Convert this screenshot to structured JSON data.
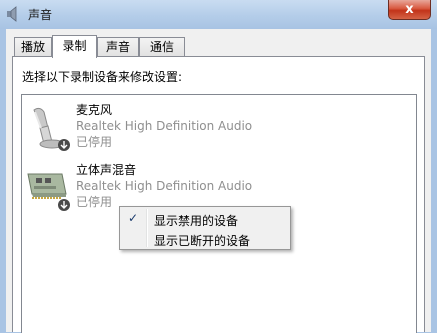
{
  "window": {
    "title": "声音",
    "title_icon": "speaker-icon",
    "close_symbol": "x"
  },
  "tabs": [
    {
      "label": "播放",
      "active": false
    },
    {
      "label": "录制",
      "active": true
    },
    {
      "label": "声音",
      "active": false
    },
    {
      "label": "通信",
      "active": false
    }
  ],
  "recording": {
    "instruction": "选择以下录制设备来修改设置:",
    "devices": [
      {
        "name": "麦克风",
        "driver": "Realtek High Definition Audio",
        "status": "已停用",
        "icon": "microphone-icon"
      },
      {
        "name": "立体声混音",
        "driver": "Realtek High Definition Audio",
        "status": "已停用",
        "icon": "sound-card-icon"
      }
    ]
  },
  "context_menu": {
    "items": [
      {
        "label": "显示禁用的设备",
        "checked": true
      },
      {
        "label": "显示已断开的设备",
        "checked": false
      }
    ],
    "check_glyph": "✓"
  },
  "colors": {
    "title_bar": "#b4cde9",
    "close_button": "#c8391f",
    "disabled_text": "#8f8f8f"
  }
}
